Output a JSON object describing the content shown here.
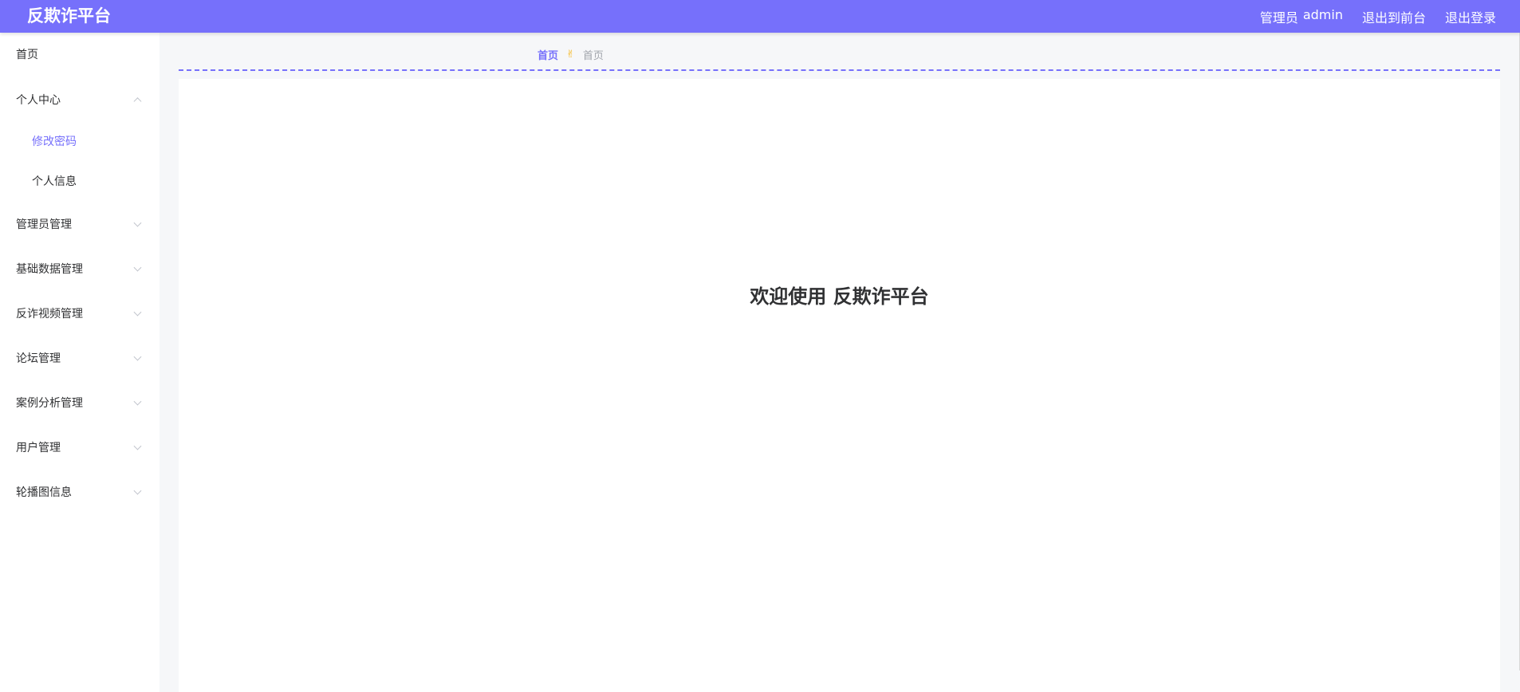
{
  "header": {
    "app_title": "反欺诈平台",
    "user_role": "管理员",
    "user_name": "admin",
    "exit_front_label": "退出到前台",
    "logout_label": "退出登录"
  },
  "sidebar": {
    "items": [
      {
        "label": "首页"
      },
      {
        "label": "个人中心"
      },
      {
        "label": "修改密码"
      },
      {
        "label": "个人信息"
      },
      {
        "label": "管理员管理"
      },
      {
        "label": "基础数据管理"
      },
      {
        "label": "反诈视频管理"
      },
      {
        "label": "论坛管理"
      },
      {
        "label": "案例分析管理"
      },
      {
        "label": "用户管理"
      },
      {
        "label": "轮播图信息"
      }
    ]
  },
  "breadcrumb": {
    "first": "首页",
    "separator": "✌",
    "current": "首页"
  },
  "main": {
    "welcome_text": "欢迎使用 反欺诈平台"
  },
  "colors": {
    "accent": "#7670fb",
    "separator": "#f5b71c"
  }
}
